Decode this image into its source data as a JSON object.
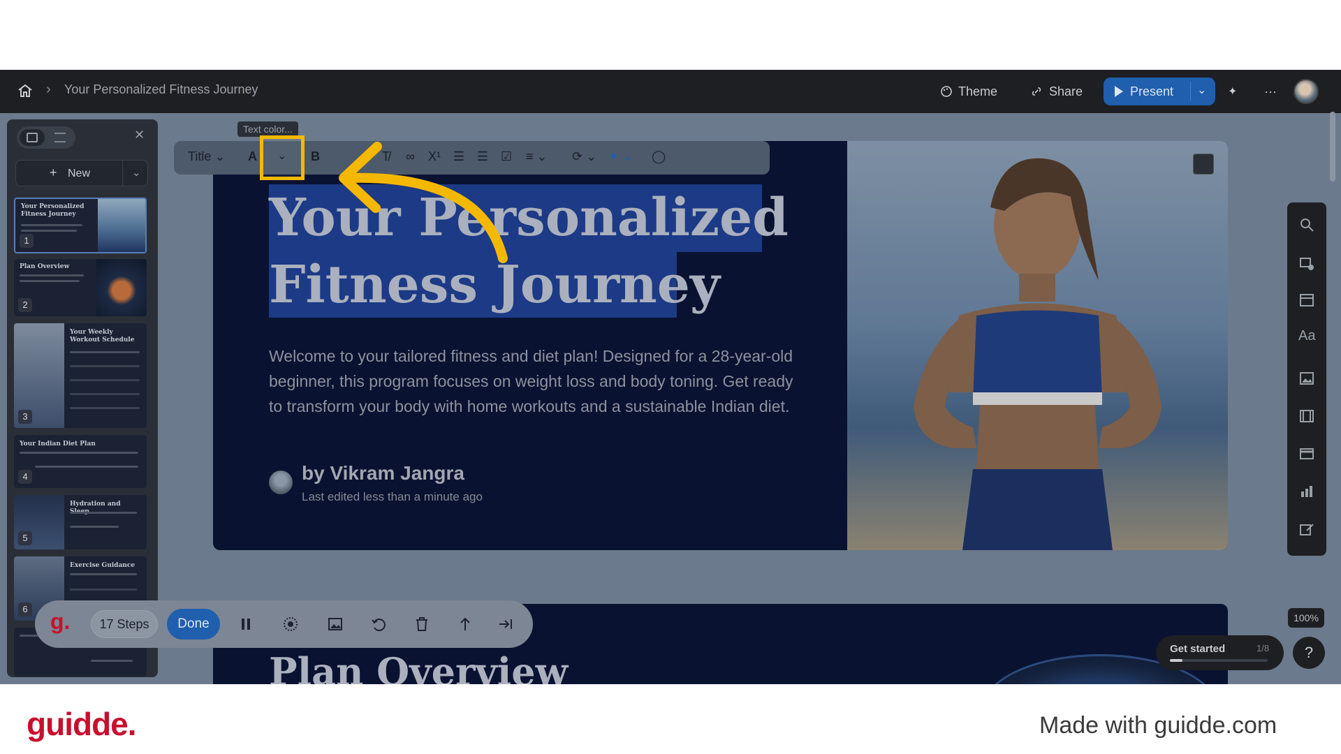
{
  "topbar": {
    "breadcrumb": "Your Personalized Fitness Journey",
    "theme_label": "Theme",
    "share_label": "Share",
    "present_label": "Present"
  },
  "sidebar": {
    "new_label": "New",
    "slides": [
      {
        "number": "1",
        "title": "Your Personalized Fitness Journey"
      },
      {
        "number": "2",
        "title": "Plan Overview"
      },
      {
        "number": "3",
        "title": "Your Weekly Workout Schedule"
      },
      {
        "number": "4",
        "title": "Your Indian Diet Plan"
      },
      {
        "number": "5",
        "title": "Hydration and Sleep"
      },
      {
        "number": "6",
        "title": "Exercise Guidance"
      }
    ]
  },
  "toolbar": {
    "style_label": "Title",
    "tooltip": "Text color..."
  },
  "slide": {
    "title_line1": "Your Personalized",
    "title_line2": "Fitness Journey",
    "body": "Welcome to your tailored fitness and diet plan! Designed for a 28-year-old beginner, this program focuses on weight loss and body toning. Get ready to transform your body with home workouts and a sustainable Indian diet.",
    "byline": "by Vikram Jangra",
    "edited": "Last edited less than a minute ago"
  },
  "next_slide": {
    "title": "Plan Overview"
  },
  "zoom": "100%",
  "get_started": {
    "label": "Get started",
    "count": "1/8",
    "progress": 0.125
  },
  "recorder": {
    "logo": "g.",
    "steps_label": "17 Steps",
    "done_label": "Done"
  },
  "footer": {
    "brand": "guidde.",
    "made_with": "Made with guidde.com"
  },
  "colors": {
    "accent_blue": "#1f5fae",
    "highlight_yellow": "#f5b800",
    "brand_red": "#c8102e"
  }
}
